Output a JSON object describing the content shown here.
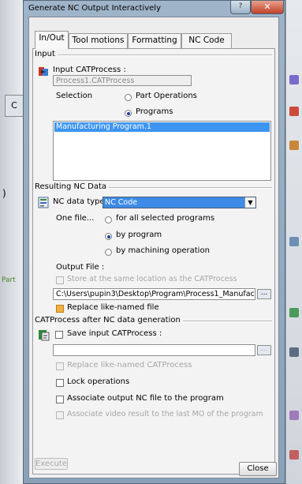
{
  "window": {
    "title": "Generate NC Output Interactively",
    "close_glyph": "✕",
    "help_glyph": "?"
  },
  "tabs": [
    {
      "label": "In/Out",
      "active": true
    },
    {
      "label": "Tool motions",
      "active": false
    },
    {
      "label": "Formatting",
      "active": false
    },
    {
      "label": "NC Code",
      "active": false
    }
  ],
  "input": {
    "group_title": "Input",
    "catprocess_label": "Input CATProcess :",
    "catprocess_value": "Process1.CATProcess",
    "selection_label": "Selection",
    "radio_part_operations": "Part Operations",
    "radio_programs": "Programs",
    "selected_option": "Programs",
    "list_items": [
      "Manufacturing Program.1"
    ]
  },
  "resulting": {
    "group_title": "Resulting NC Data",
    "nc_data_type_label": "NC data type:",
    "nc_data_type_value": "NC Code",
    "one_file_label": "One file...",
    "radio_all_programs": "for all selected programs",
    "radio_by_program": "by program",
    "radio_by_machining": "by machining operation",
    "selected_option": "by program",
    "output_file_label": "Output File :",
    "store_same_location": "Store at the same location as the CATProcess",
    "output_path": "C:\\Users\\pupin3\\Desktop\\Program\\Process1_Manufac",
    "browse_label": "...",
    "replace_like_named": "Replace like-named file",
    "replace_checked": true
  },
  "after": {
    "group_title": "CATProcess after NC data generation",
    "save_input": "Save input CATProcess :",
    "save_path": "",
    "browse_label": "...",
    "replace_catprocess": "Replace like-named CATProcess",
    "lock_operations": "Lock operations",
    "associate_output": "Associate output NC file to the program",
    "associate_video": "Associate video result to the last MO of the program"
  },
  "buttons": {
    "execute": "Execute",
    "close": "Close"
  },
  "colors": {
    "selection_blue": "#3d95f0",
    "checked_orange": "#f0b044",
    "radio_dot": "#1b3e98"
  }
}
